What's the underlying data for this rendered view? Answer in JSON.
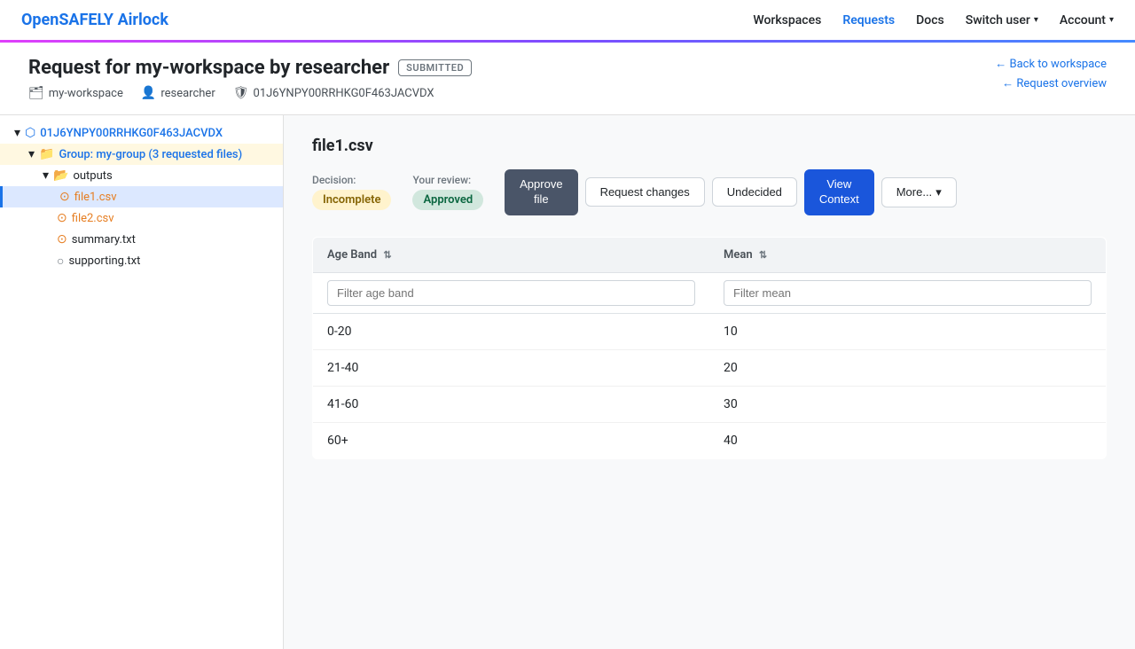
{
  "brand": {
    "prefix": "OpenSAFELY",
    "suffix": "Airlock"
  },
  "nav": {
    "workspaces": "Workspaces",
    "requests": "Requests",
    "docs": "Docs",
    "switch_user": "Switch user",
    "account": "Account"
  },
  "page_header": {
    "title_prefix": "Request for my-workspace by",
    "title_researcher": "researcher",
    "badge": "SUBMITTED",
    "meta_workspace": "my-workspace",
    "meta_user": "researcher",
    "meta_id": "01J6YNPY00RRHKG0F463JACVDX",
    "back_link": "← Back to workspace",
    "request_overview": "← Request overview"
  },
  "tree": {
    "root_id": "01J6YNPY00RRHKG0F463JACVDX",
    "group_label": "Group: my-group (3 requested files)",
    "outputs_label": "outputs",
    "files": [
      {
        "name": "file1.csv",
        "type": "csv",
        "selected": true
      },
      {
        "name": "file2.csv",
        "type": "csv",
        "selected": false
      },
      {
        "name": "summary.txt",
        "type": "txt",
        "selected": false
      },
      {
        "name": "supporting.txt",
        "type": "txt",
        "selected": false
      }
    ]
  },
  "file_view": {
    "filename": "file1.csv",
    "decision_label": "Decision:",
    "decision_value": "Incomplete",
    "review_label": "Your review:",
    "review_value": "Approved",
    "buttons": {
      "approve_line1": "Approve",
      "approve_line2": "file",
      "request_changes": "Request changes",
      "undecided": "Undecided",
      "view_context_line1": "View",
      "view_context_line2": "Context",
      "more": "More..."
    },
    "table": {
      "col1_header": "Age Band",
      "col2_header": "Mean",
      "col1_filter_placeholder": "Filter age band",
      "col2_filter_placeholder": "Filter mean",
      "rows": [
        {
          "age_band": "0-20",
          "mean": "10"
        },
        {
          "age_band": "21-40",
          "mean": "20"
        },
        {
          "age_band": "41-60",
          "mean": "30"
        },
        {
          "age_band": "60+",
          "mean": "40"
        }
      ]
    }
  }
}
